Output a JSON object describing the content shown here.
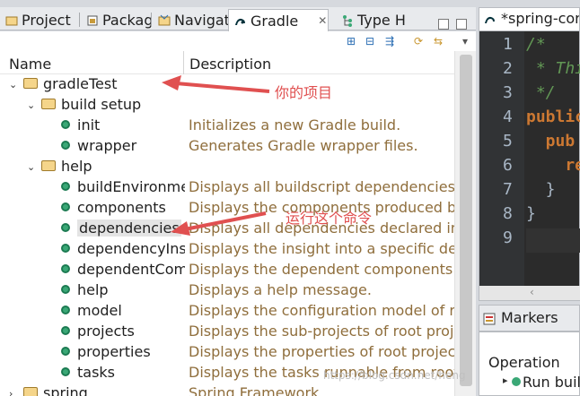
{
  "tabs": [
    {
      "label": "Project",
      "icon": "project-explorer-icon"
    },
    {
      "label": "Packag",
      "icon": "package-explorer-icon"
    },
    {
      "label": "Navigat",
      "icon": "navigator-icon"
    },
    {
      "label": "Gradle",
      "icon": "gradle-icon",
      "active": true
    },
    {
      "label": "Type H",
      "icon": "type-hierarchy-icon"
    }
  ],
  "tab_close": "✕",
  "columns": {
    "name": "Name",
    "description": "Description"
  },
  "tree": [
    {
      "name": "gradleTest",
      "type": "project",
      "level": 0,
      "expanded": true,
      "desc": ""
    },
    {
      "name": "build setup",
      "type": "folder",
      "level": 1,
      "expanded": true,
      "desc": ""
    },
    {
      "name": "init",
      "type": "task",
      "level": 2,
      "desc": "Initializes a new Gradle build."
    },
    {
      "name": "wrapper",
      "type": "task",
      "level": 2,
      "desc": "Generates Gradle wrapper files."
    },
    {
      "name": "help",
      "type": "folder",
      "level": 1,
      "expanded": true,
      "desc": ""
    },
    {
      "name": "buildEnvironmer",
      "type": "task",
      "level": 2,
      "desc": "Displays all buildscript dependencies dec"
    },
    {
      "name": "components",
      "type": "task",
      "level": 2,
      "desc": "Displays the components produced by ro"
    },
    {
      "name": "dependencies",
      "type": "task",
      "level": 2,
      "desc": "Displays all dependencies declared in roo",
      "selected": true
    },
    {
      "name": "dependencyInsi",
      "type": "task",
      "level": 2,
      "desc": "Displays the insight into a specific depen"
    },
    {
      "name": "dependentCom",
      "type": "task",
      "level": 2,
      "desc": "Displays the dependent components of c"
    },
    {
      "name": "help",
      "type": "task",
      "level": 2,
      "desc": "Displays a help message."
    },
    {
      "name": "model",
      "type": "task",
      "level": 2,
      "desc": "Displays the configuration model of root"
    },
    {
      "name": "projects",
      "type": "task",
      "level": 2,
      "desc": "Displays the sub-projects of root project"
    },
    {
      "name": "properties",
      "type": "task",
      "level": 2,
      "desc": "Displays the properties of root project 'g"
    },
    {
      "name": "tasks",
      "type": "task",
      "level": 2,
      "desc": "Displays the tasks runnable from root pro"
    },
    {
      "name": "spring",
      "type": "project",
      "level": 0,
      "expanded": false,
      "desc": "Spring Framework"
    }
  ],
  "annotations": {
    "project": "你的项目",
    "command": "运行这个命令"
  },
  "editor": {
    "tab_label": "*spring-core",
    "line_numbers": [
      "1",
      "2",
      "3",
      "4",
      "5",
      "6",
      "7",
      "8",
      "9"
    ],
    "lines": [
      "/*",
      " * This",
      " */",
      "public",
      "  pub",
      "    re",
      "  }",
      "}",
      ""
    ]
  },
  "bottom": {
    "tab_label": "Markers",
    "column": "Operation",
    "row": "Run build"
  },
  "watermark": "https://blog.csdn.net/heng"
}
